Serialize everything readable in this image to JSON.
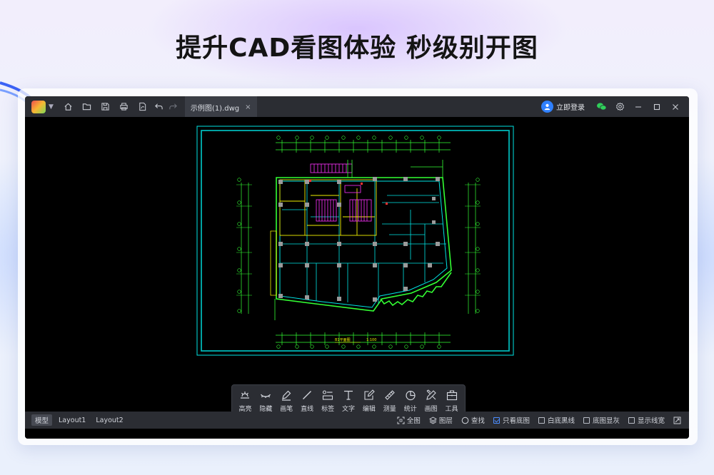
{
  "headline": "提升CAD看图体验  秒级别开图",
  "titlebar": {
    "tab_label": "示例图(1).dwg",
    "tab_close": "×",
    "login_label": "立即登录"
  },
  "drawing": {
    "title_label": "B1平面图",
    "scale_label": "1:100"
  },
  "toolbox": {
    "items": [
      {
        "label": "高亮"
      },
      {
        "label": "隐藏"
      },
      {
        "label": "画笔"
      },
      {
        "label": "直线"
      },
      {
        "label": "标签"
      },
      {
        "label": "文字"
      },
      {
        "label": "编辑"
      },
      {
        "label": "测量"
      },
      {
        "label": "统计"
      },
      {
        "label": "画图"
      },
      {
        "label": "工具"
      }
    ]
  },
  "statusbar": {
    "layouts": [
      "模型",
      "Layout1",
      "Layout2"
    ],
    "full_view": "全图",
    "layers": "图层",
    "find": "查找",
    "only_base": "只看底图",
    "white_black": "白底黑线",
    "base_gray": "底图显灰",
    "line_width": "显示线宽"
  },
  "colors": {
    "accent": "#2f80ff",
    "cad_cyan": "#00e5e5",
    "cad_green": "#33ff33",
    "cad_magenta": "#ff33ff",
    "cad_yellow": "#f0f000"
  }
}
